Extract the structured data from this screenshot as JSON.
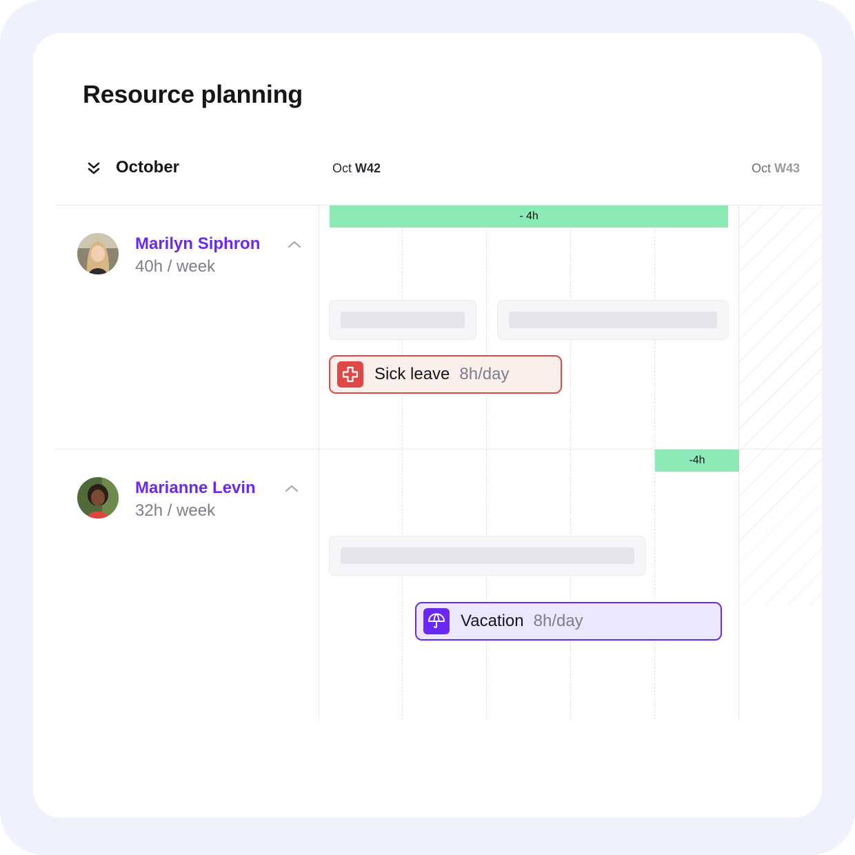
{
  "page": {
    "title": "Resource planning"
  },
  "timeline": {
    "month": "October",
    "weeks": [
      {
        "month": "Oct",
        "week": "W42"
      },
      {
        "month": "Oct",
        "week": "W43"
      }
    ]
  },
  "people": [
    {
      "name": "Marilyn Siphron",
      "hours": "40h / week",
      "capacity": "- 4h",
      "absence": {
        "label": "Sick leave",
        "rate": "8h/day",
        "icon": "medical-cross-icon",
        "color": "#e04848"
      }
    },
    {
      "name": "Marianne Levin",
      "hours": "32h / week",
      "capacity": "-4h",
      "absence": {
        "label": "Vacation",
        "rate": "8h/day",
        "icon": "umbrella-icon",
        "color": "#6a28f5"
      }
    }
  ],
  "colors": {
    "accent": "#6a28f5",
    "capacity": "#8ceab7",
    "sick_border": "#e04848",
    "sick_bg": "#fbefeb",
    "vacation_border": "#6a28f5",
    "vacation_bg": "#ece7fd"
  }
}
